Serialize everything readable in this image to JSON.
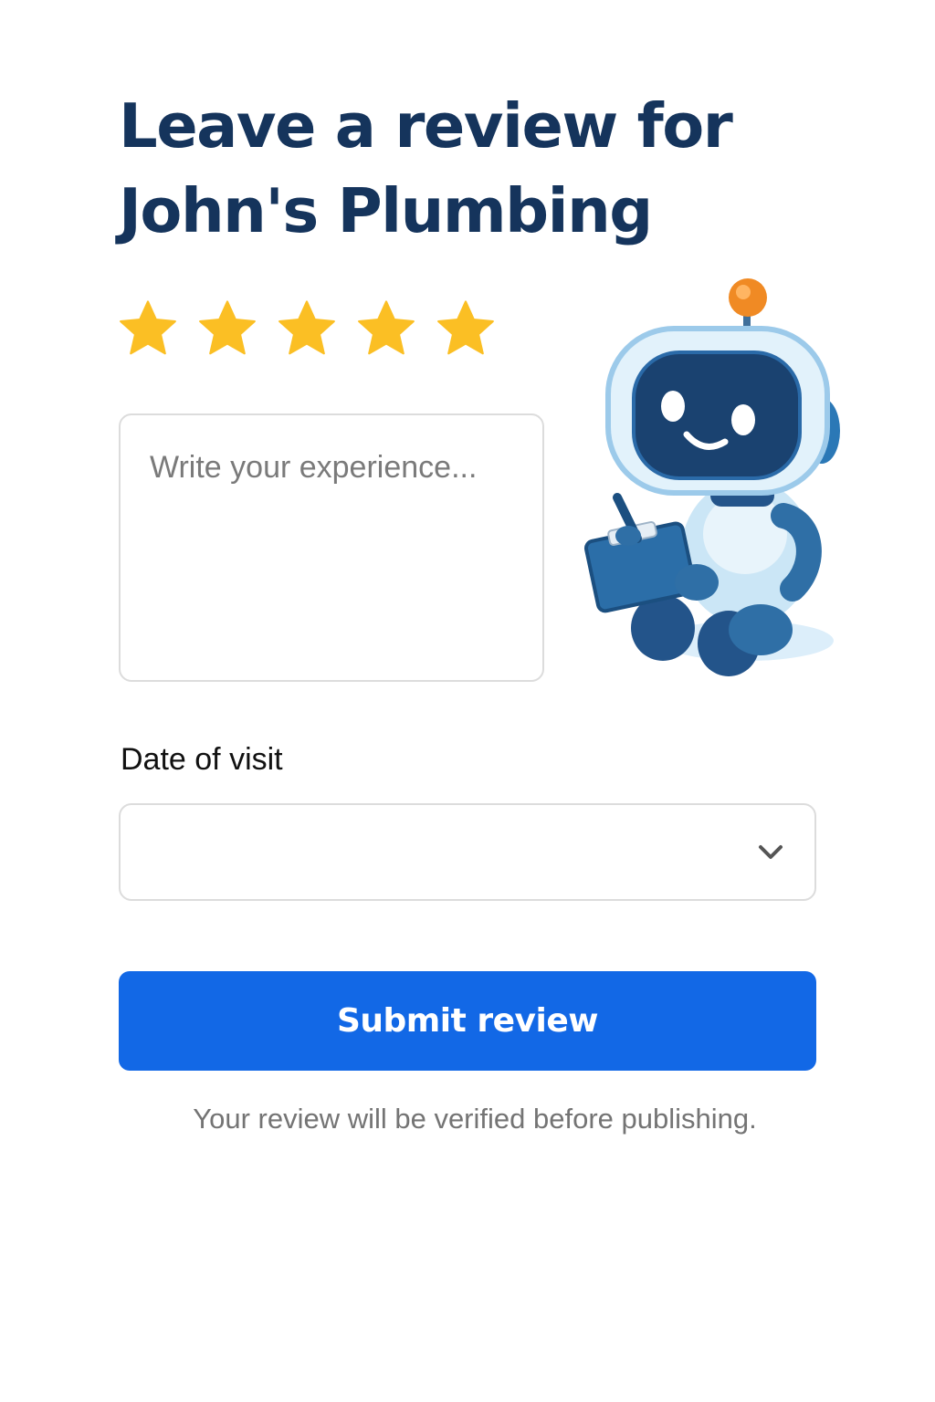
{
  "header": {
    "title_line1": "Leave a review for",
    "title_line2": "John's Plumbing"
  },
  "rating": {
    "value": 5,
    "max": 5,
    "star_color": "#FBBF24"
  },
  "review": {
    "placeholder": "Write your experience..."
  },
  "date": {
    "label": "Date of visit",
    "value": ""
  },
  "submit": {
    "label": "Submit review",
    "color": "#1268E6"
  },
  "note": "Your review will be verified before publishing.",
  "illustration": {
    "icon": "robot-with-clipboard-illustration"
  }
}
